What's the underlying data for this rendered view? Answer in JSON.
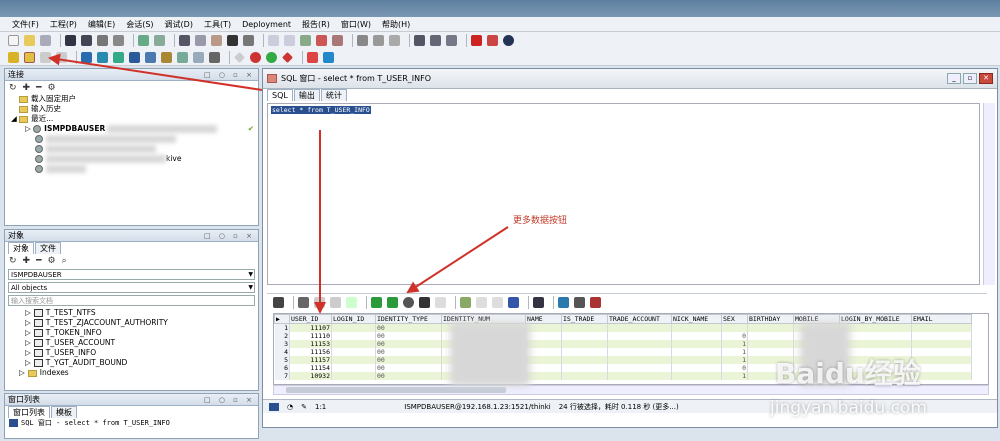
{
  "menu": [
    "文件(F)",
    "工程(P)",
    "编辑(E)",
    "会话(S)",
    "调试(D)",
    "工具(T)",
    "Deployment",
    "报告(R)",
    "窗口(W)",
    "帮助(H)"
  ],
  "connections": {
    "title": "连接",
    "items": [
      "载入固定用户",
      "输入历史",
      "最近...",
      "ISMPDBAUSER"
    ],
    "hidden_suffix": "kive"
  },
  "objects": {
    "title": "对象",
    "tabs": [
      "对象",
      "文件"
    ],
    "user": "ISMPDBAUSER",
    "filter": "All objects",
    "search_placeholder": "输入搜索文档",
    "items": [
      "T_TEST_NTFS",
      "T_TEST_ZJACCOUNT_AUTHORITY",
      "T_TOKEN_INFO",
      "T_USER_ACCOUNT",
      "T_USER_INFO",
      "T_YGT_AUDIT_BOUND",
      "Indexes"
    ]
  },
  "window_list": {
    "title": "窗口列表",
    "tabs": [
      "窗口列表",
      "模板"
    ],
    "item": "SQL 窗口 - select * from T_USER_INFO"
  },
  "sql_window": {
    "title": "SQL 窗口 - select * from T_USER_INFO",
    "tabs": [
      "SQL",
      "输出",
      "统计"
    ],
    "query": "select * from T_USER_INFO"
  },
  "annotation": "更多数据按钮",
  "grid": {
    "columns": [
      "USER_ID",
      "LOGIN_ID",
      "IDENTITY_TYPE",
      "IDENTITY_NUM",
      "NAME",
      "IS_TRADE",
      "TRADE_ACCOUNT",
      "NICK_NAME",
      "SEX",
      "BIRTHDAY",
      "MOBILE",
      "LOGIN_BY_MOBILE",
      "EMAIL"
    ],
    "rows": [
      {
        "n": "1",
        "id": "11107",
        "type": "00",
        "sex": ""
      },
      {
        "n": "2",
        "id": "11110",
        "type": "00",
        "sex": "0"
      },
      {
        "n": "3",
        "id": "11153",
        "type": "00",
        "sex": "1"
      },
      {
        "n": "4",
        "id": "11156",
        "type": "00",
        "sex": "1"
      },
      {
        "n": "5",
        "id": "11157",
        "type": "00",
        "sex": "1"
      },
      {
        "n": "6",
        "id": "11154",
        "type": "00",
        "sex": "0"
      },
      {
        "n": "7",
        "id": "10932",
        "type": "00",
        "sex": "1"
      }
    ]
  },
  "status": {
    "pos": "1:1",
    "connection": "ISMPDBAUSER@192.168.1.23:1521/thinki",
    "message": "24 行被选择，耗时 0.118 秒 (更多...)"
  },
  "watermark": {
    "brand": "Baidu经验",
    "url": "jingyan.baidu.com"
  }
}
